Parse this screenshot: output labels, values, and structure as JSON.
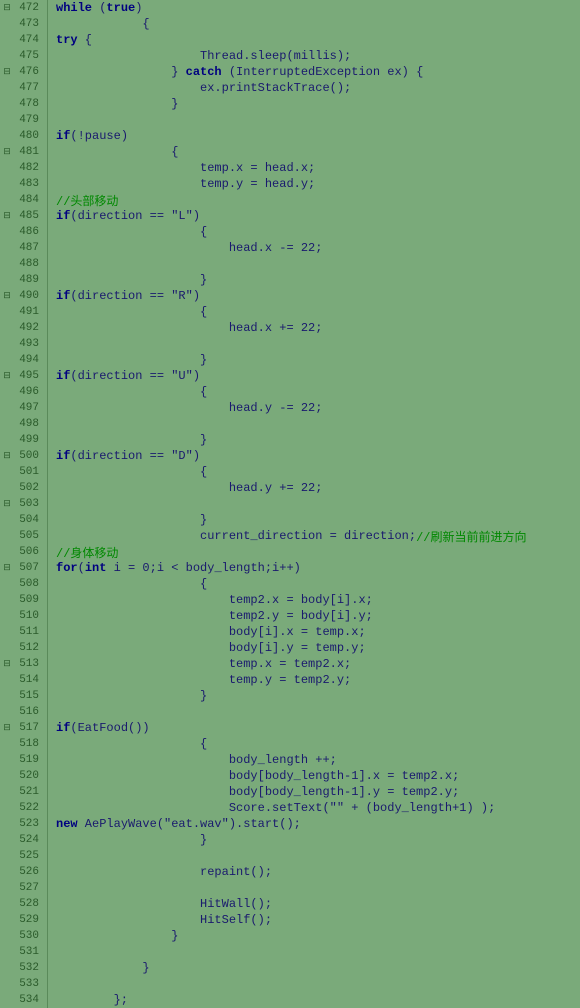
{
  "lines": [
    {
      "num": 472,
      "fold": true,
      "indent": 3,
      "code": "while (true)"
    },
    {
      "num": 473,
      "fold": false,
      "indent": 3,
      "code": "{"
    },
    {
      "num": 474,
      "fold": false,
      "indent": 4,
      "code": "try {"
    },
    {
      "num": 475,
      "fold": false,
      "indent": 5,
      "code": "Thread.sleep(millis);"
    },
    {
      "num": 476,
      "fold": true,
      "indent": 4,
      "code": "} catch (InterruptedException ex) {"
    },
    {
      "num": 477,
      "fold": false,
      "indent": 5,
      "code": "ex.printStackTrace();"
    },
    {
      "num": 478,
      "fold": false,
      "indent": 4,
      "code": "}"
    },
    {
      "num": 479,
      "fold": false,
      "indent": 4,
      "code": ""
    },
    {
      "num": 480,
      "fold": false,
      "indent": 4,
      "code": "if(!pause)"
    },
    {
      "num": 481,
      "fold": true,
      "indent": 4,
      "code": "{"
    },
    {
      "num": 482,
      "fold": false,
      "indent": 5,
      "code": "temp.x = head.x;"
    },
    {
      "num": 483,
      "fold": false,
      "indent": 5,
      "code": "temp.y = head.y;"
    },
    {
      "num": 484,
      "fold": false,
      "indent": 5,
      "code": "//头部移动"
    },
    {
      "num": 485,
      "fold": true,
      "indent": 5,
      "code": "if(direction == \"L\")"
    },
    {
      "num": 486,
      "fold": false,
      "indent": 5,
      "code": "{"
    },
    {
      "num": 487,
      "fold": false,
      "indent": 6,
      "code": "head.x -= 22;"
    },
    {
      "num": 488,
      "fold": false,
      "indent": 5,
      "code": ""
    },
    {
      "num": 489,
      "fold": false,
      "indent": 5,
      "code": "}"
    },
    {
      "num": 490,
      "fold": true,
      "indent": 5,
      "code": "if(direction == \"R\")"
    },
    {
      "num": 491,
      "fold": false,
      "indent": 5,
      "code": "{"
    },
    {
      "num": 492,
      "fold": false,
      "indent": 6,
      "code": "head.x += 22;"
    },
    {
      "num": 493,
      "fold": false,
      "indent": 5,
      "code": ""
    },
    {
      "num": 494,
      "fold": false,
      "indent": 5,
      "code": "}"
    },
    {
      "num": 495,
      "fold": true,
      "indent": 5,
      "code": "if(direction == \"U\")"
    },
    {
      "num": 496,
      "fold": false,
      "indent": 5,
      "code": "{"
    },
    {
      "num": 497,
      "fold": false,
      "indent": 6,
      "code": "head.y -= 22;"
    },
    {
      "num": 498,
      "fold": false,
      "indent": 5,
      "code": ""
    },
    {
      "num": 499,
      "fold": false,
      "indent": 5,
      "code": "}"
    },
    {
      "num": 500,
      "fold": true,
      "indent": 5,
      "code": "if(direction == \"D\")"
    },
    {
      "num": 501,
      "fold": false,
      "indent": 5,
      "code": "{"
    },
    {
      "num": 502,
      "fold": false,
      "indent": 6,
      "code": "head.y += 22;"
    },
    {
      "num": 503,
      "fold": false,
      "indent": 5,
      "code": ""
    },
    {
      "num": 504,
      "fold": false,
      "indent": 5,
      "code": "}"
    },
    {
      "num": 505,
      "fold": false,
      "indent": 5,
      "code": "current_direction = direction;//刷新当前前进方向"
    },
    {
      "num": 506,
      "fold": false,
      "indent": 5,
      "code": "//身体移动"
    },
    {
      "num": 507,
      "fold": true,
      "indent": 5,
      "code": "for(int i = 0;i < body_length;i++)"
    },
    {
      "num": 508,
      "fold": false,
      "indent": 5,
      "code": "{"
    },
    {
      "num": 509,
      "fold": false,
      "indent": 6,
      "code": "temp2.x = body[i].x;"
    },
    {
      "num": 510,
      "fold": false,
      "indent": 6,
      "code": "temp2.y = body[i].y;"
    },
    {
      "num": 511,
      "fold": false,
      "indent": 6,
      "code": "body[i].x = temp.x;"
    },
    {
      "num": 512,
      "fold": false,
      "indent": 6,
      "code": "body[i].y = temp.y;"
    },
    {
      "num": 513,
      "fold": false,
      "indent": 6,
      "code": "temp.x = temp2.x;"
    },
    {
      "num": 514,
      "fold": false,
      "indent": 6,
      "code": "temp.y = temp2.y;"
    },
    {
      "num": 515,
      "fold": false,
      "indent": 5,
      "code": "}"
    },
    {
      "num": 516,
      "fold": false,
      "indent": 5,
      "code": ""
    },
    {
      "num": 517,
      "fold": true,
      "indent": 5,
      "code": "if(EatFood())"
    },
    {
      "num": 518,
      "fold": false,
      "indent": 5,
      "code": "{"
    },
    {
      "num": 519,
      "fold": false,
      "indent": 6,
      "code": "body_length ++;"
    },
    {
      "num": 520,
      "fold": false,
      "indent": 6,
      "code": "body[body_length-1].x = temp2.x;"
    },
    {
      "num": 521,
      "fold": false,
      "indent": 6,
      "code": "body[body_length-1].y = temp2.y;"
    },
    {
      "num": 522,
      "fold": false,
      "indent": 6,
      "code": "Score.setText(\"\" + (body_length+1) );"
    },
    {
      "num": 523,
      "fold": false,
      "indent": 6,
      "code": "new AePlayWave(\"eat.wav\").start();"
    },
    {
      "num": 524,
      "fold": false,
      "indent": 5,
      "code": "}"
    },
    {
      "num": 525,
      "fold": false,
      "indent": 5,
      "code": ""
    },
    {
      "num": 526,
      "fold": false,
      "indent": 5,
      "code": "repaint();"
    },
    {
      "num": 527,
      "fold": false,
      "indent": 5,
      "code": ""
    },
    {
      "num": 528,
      "fold": false,
      "indent": 5,
      "code": "HitWall();"
    },
    {
      "num": 529,
      "fold": false,
      "indent": 5,
      "code": "HitSelf();"
    },
    {
      "num": 530,
      "fold": false,
      "indent": 4,
      "code": "}"
    },
    {
      "num": 531,
      "fold": false,
      "indent": 4,
      "code": ""
    },
    {
      "num": 532,
      "fold": false,
      "indent": 3,
      "code": "}"
    },
    {
      "num": 533,
      "fold": false,
      "indent": 2,
      "code": ""
    },
    {
      "num": 534,
      "fold": false,
      "indent": 2,
      "code": "};"
    }
  ],
  "foldable_lines": [
    472,
    476,
    481,
    485,
    490,
    495,
    500,
    503,
    507,
    513,
    517
  ]
}
